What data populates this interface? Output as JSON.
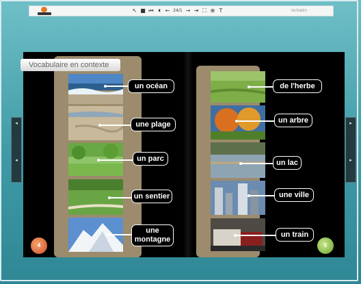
{
  "toolbar": {
    "right_text": "Verbatim",
    "tools": [
      {
        "name": "pointer-icon",
        "glyph": "↖"
      },
      {
        "name": "page-icon",
        "glyph": "■"
      },
      {
        "name": "first-page-icon",
        "glyph": "⏮"
      },
      {
        "name": "prev-page-icon",
        "glyph": "⏴"
      },
      {
        "name": "back-icon",
        "glyph": "←"
      },
      {
        "name": "page-number-field",
        "glyph": "24/1"
      },
      {
        "name": "forward-icon",
        "glyph": "→"
      },
      {
        "name": "last-page-icon",
        "glyph": "⇥"
      },
      {
        "name": "fit-icon",
        "glyph": "⛶"
      },
      {
        "name": "zoom-icon",
        "glyph": "⊕"
      },
      {
        "name": "text-tool-icon",
        "glyph": "T"
      }
    ]
  },
  "page_left": {
    "title": "Vocabulaire en contexte",
    "items": [
      {
        "label": "un océan"
      },
      {
        "label": "une plage"
      },
      {
        "label": "un parc"
      },
      {
        "label": "un sentier"
      },
      {
        "label": "une montagne"
      }
    ]
  },
  "page_right": {
    "items": [
      {
        "label": "de l'herbe"
      },
      {
        "label": "un arbre"
      },
      {
        "label": "un lac"
      },
      {
        "label": "une ville"
      },
      {
        "label": "un train"
      }
    ]
  },
  "badges": {
    "left": "4",
    "right": "5"
  },
  "colors": {
    "background": "#3e9aa6",
    "panel": "#9c8b6d",
    "label_bg": "#000000"
  }
}
